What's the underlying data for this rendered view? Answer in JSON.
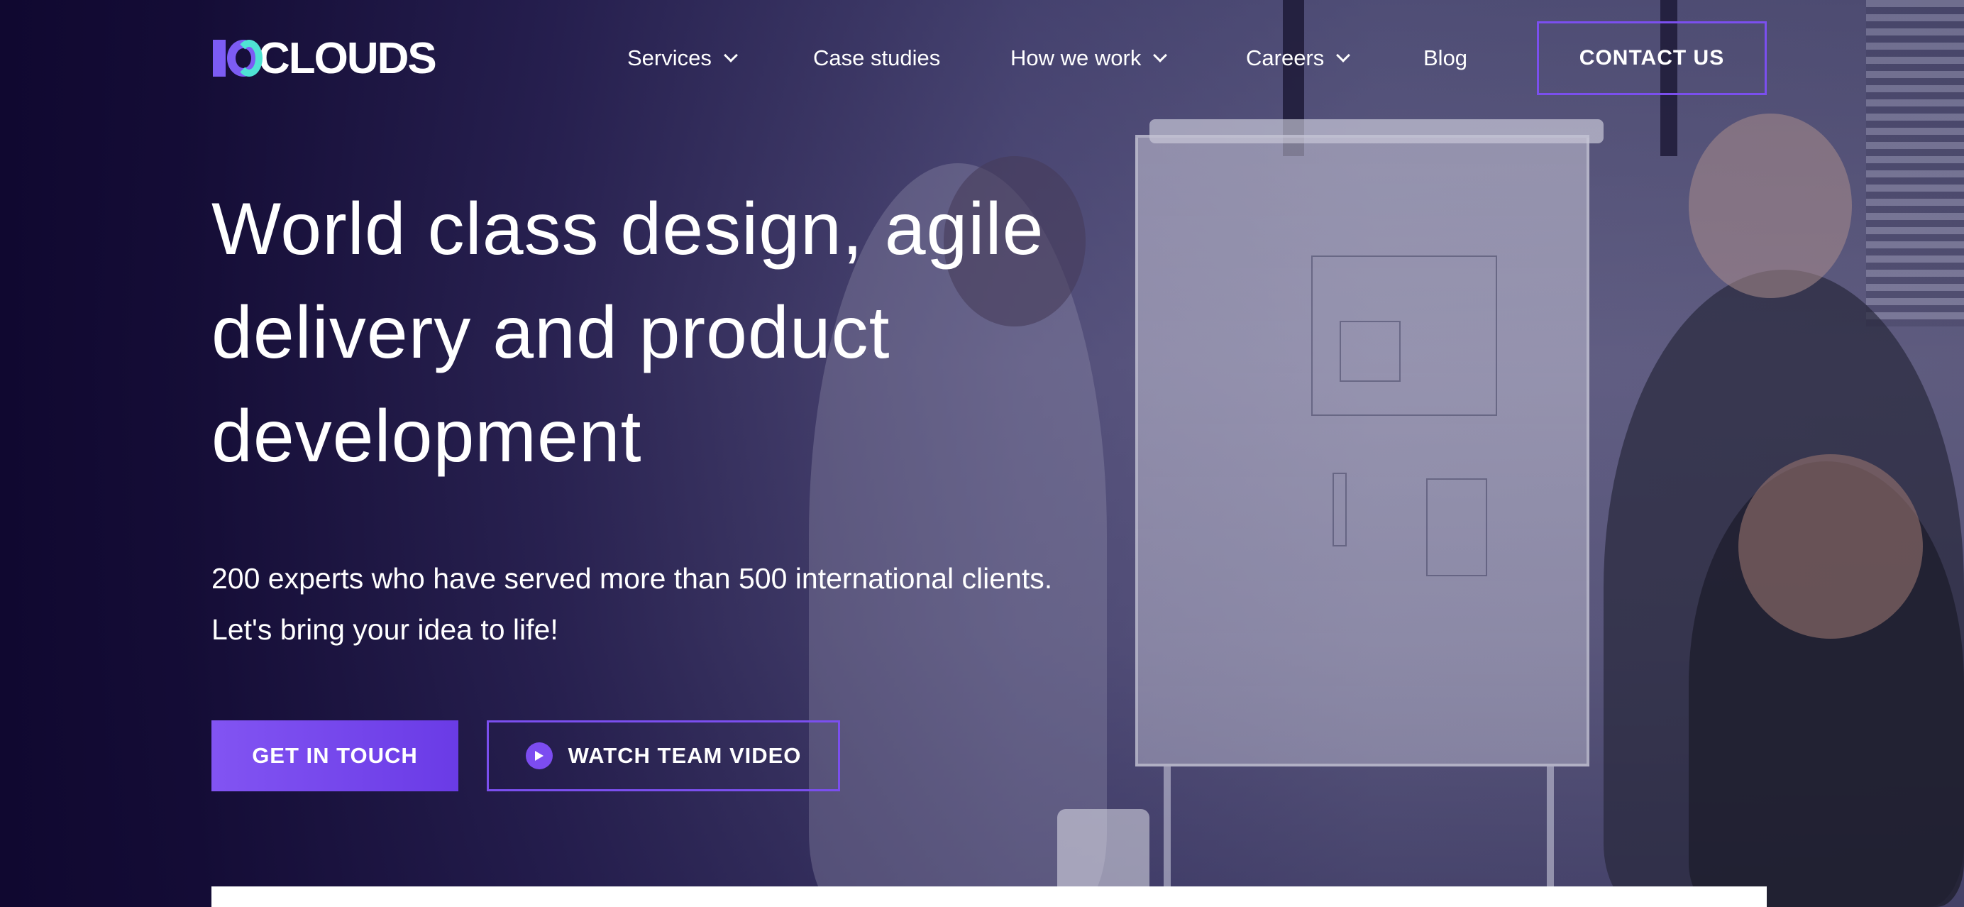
{
  "brand": {
    "logo_text": "CLOUDS",
    "accent": "#7b4fef",
    "logo_cyan": "#4fe3d4",
    "background": "#120a33"
  },
  "nav": {
    "items": [
      {
        "label": "Services",
        "has_dropdown": true
      },
      {
        "label": "Case studies",
        "has_dropdown": false
      },
      {
        "label": "How we work",
        "has_dropdown": true
      },
      {
        "label": "Careers",
        "has_dropdown": true
      },
      {
        "label": "Blog",
        "has_dropdown": false
      }
    ],
    "contact_label": "CONTACT US"
  },
  "hero": {
    "headline_lines": [
      "World class design, agile",
      "delivery and product",
      "development"
    ],
    "sub_lines": [
      "200 experts who have served more than 500 international clients.",
      "Let's bring your idea to life!"
    ],
    "primary_cta": "GET IN TOUCH",
    "secondary_cta": "WATCH TEAM VIDEO"
  },
  "icons": {
    "logo": "10clouds-logo-mark",
    "dropdown": "chevron-down-icon",
    "video": "play-icon"
  }
}
